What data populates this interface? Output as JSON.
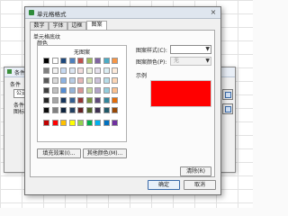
{
  "background_window": {
    "title": "条件格",
    "condition_label": "条件",
    "combo_value": "公式",
    "extra_label_1": "条件为",
    "extra_label_2": "图标为"
  },
  "dialog": {
    "title": "单元格格式",
    "tabs": [
      "数字",
      "字体",
      "边框",
      "图案"
    ],
    "active_tab": "图案",
    "shading_label": "单元格底纹",
    "color_label": "颜色",
    "no_fill_label": "无图案",
    "pattern_style_label": "图案样式(C):",
    "pattern_color_label": "图案颜色(P):",
    "pattern_color_value": "无",
    "sample_label": "示例",
    "sample_color": "#ff0000",
    "fill_effects_button": "填充效果(I)...",
    "more_colors_button": "其他颜色(M)...",
    "clear_button": "清除(R)",
    "ok_button": "确定",
    "cancel_button": "取消",
    "close_glyph": "×"
  },
  "palette": [
    [
      "#000000",
      "#ffffff",
      "#1f497d",
      "#4f81bd",
      "#c0504d",
      "#9bbb59",
      "#8064a2",
      "#4bacc6",
      "#f79646"
    ],
    [
      "#7f7f7f",
      "#f2f2f2",
      "#c6d9f1",
      "#dbe5f1",
      "#f2dcdb",
      "#ebf1dd",
      "#e5e0ec",
      "#dbeef3",
      "#fdeada"
    ],
    [
      "#595959",
      "#d9d9d9",
      "#8db3e2",
      "#b8cce4",
      "#e6b8b7",
      "#d7e3bc",
      "#ccc1d9",
      "#b7dde8",
      "#fbd5b5"
    ],
    [
      "#3f3f3f",
      "#bfbfbf",
      "#548dd4",
      "#95b3d7",
      "#d99694",
      "#c3d69b",
      "#b2a2c7",
      "#92cddc",
      "#fac08f"
    ],
    [
      "#262626",
      "#a6a6a6",
      "#17365d",
      "#366092",
      "#953734",
      "#76923c",
      "#5f497a",
      "#31859b",
      "#e36c09"
    ],
    [
      "#0c0c0c",
      "#808080",
      "#0f243e",
      "#244061",
      "#632423",
      "#4f6128",
      "#3f3151",
      "#205867",
      "#974806"
    ],
    [
      "#c00000",
      "#ff0000",
      "#ffc000",
      "#ffff00",
      "#92d050",
      "#00b050",
      "#00b0f0",
      "#0070c0",
      "#7030a0"
    ]
  ]
}
